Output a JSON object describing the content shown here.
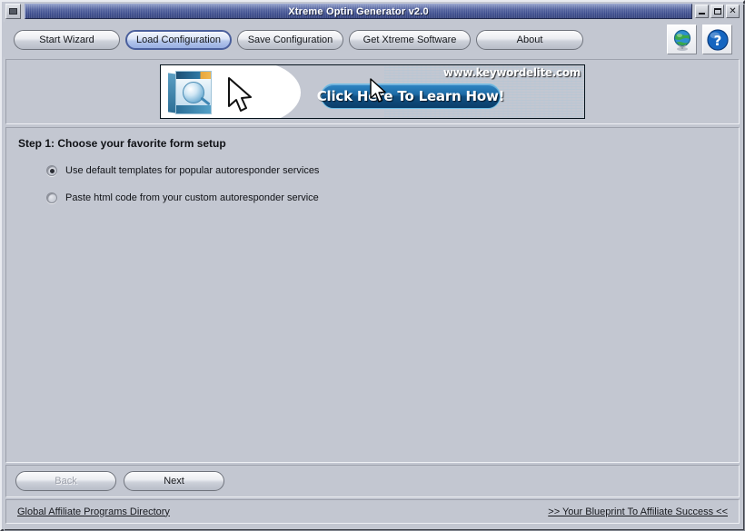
{
  "window": {
    "title": "Xtreme Optin Generator v2.0",
    "sysmenu_icon": "system-menu-icon",
    "controls": [
      {
        "name": "minimize",
        "glyph": "_"
      },
      {
        "name": "maximize",
        "glyph": "□"
      },
      {
        "name": "close",
        "glyph": "✕"
      }
    ]
  },
  "toolbar": {
    "buttons": [
      {
        "label": "Start Wizard",
        "state": "normal"
      },
      {
        "label": "Load Configuration",
        "state": "active"
      },
      {
        "label": "Save Configuration",
        "state": "normal"
      },
      {
        "label": "Get Xtreme Software",
        "state": "normal"
      },
      {
        "label": "About",
        "state": "normal"
      }
    ],
    "icons": [
      {
        "name": "globe-icon",
        "title": "globe"
      },
      {
        "name": "help-icon",
        "title": "help"
      }
    ]
  },
  "banner": {
    "cta_text": "Click Here To Learn How!",
    "url_text": "www.keywordelite.com",
    "product_box_alt": "Keyword Elite software box",
    "arrow_alt": "pointing arrow graphic"
  },
  "main": {
    "step_title": "Step 1: Choose your favorite form setup",
    "options": [
      {
        "label": "Use default templates for popular autoresponder services",
        "selected": true
      },
      {
        "label": "Paste html code from your custom autoresponder service",
        "selected": false
      }
    ]
  },
  "nav": {
    "back_label": "Back",
    "back_disabled": true,
    "next_label": "Next",
    "next_disabled": false
  },
  "status": {
    "left_link": "Global Affiliate Programs Directory",
    "right_link": ">> Your Blueprint To Affiliate Success <<"
  },
  "colors": {
    "window_face": "#c3c7d1",
    "titlebar_blue": "#3c4c8c",
    "active_button_border": "#4a5f9c",
    "banner_dark": "#0b2troop",
    "link_text": "#16181d"
  }
}
